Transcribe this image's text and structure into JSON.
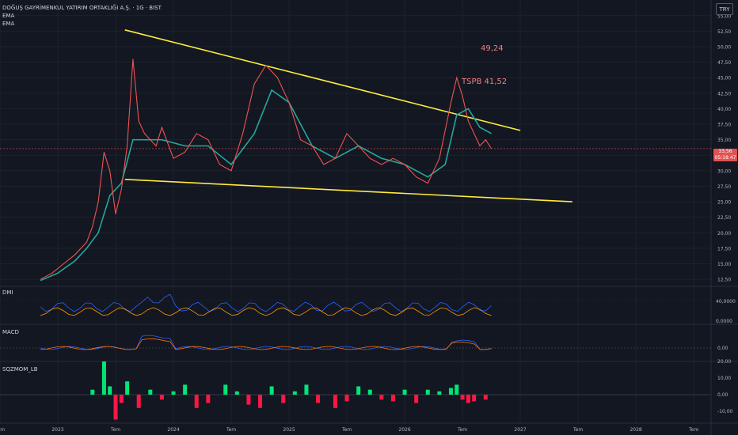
{
  "header": {
    "symbol_line": "DOĞUŞ GAYRİMENKUL YATIRIM ORTAKLIĞI A.Ş. · 1G · BIST",
    "ind1": "EMA",
    "ind2": "EMA"
  },
  "currency": "TRY",
  "annotations": {
    "target": "49,24",
    "tspb": "TSPB  41,52"
  },
  "price_badge": {
    "price": "33,56",
    "countdown": "05:18:47"
  },
  "pane_labels": {
    "dmi": "DMI",
    "macd": "MACD",
    "sqz": "SQZMOM_LB"
  },
  "colors": {
    "background": "#131722",
    "trendline": "#ffeb3b",
    "price": "#ef5350",
    "ema": "#26a69a",
    "dmi_plus": "#2962ff",
    "dmi_minus": "#ff9800",
    "sqz_up": "#00e676",
    "sqz_down": "#ff1744"
  },
  "chart_data": {
    "type": "line",
    "x_axis": {
      "ticks": [
        "Tem",
        "2023",
        "Tem",
        "2024",
        "Tem",
        "2025",
        "Tem",
        "2026",
        "Tem",
        "2027",
        "Tem",
        "2028",
        "Tem"
      ]
    },
    "y_axis": {
      "ticks": [
        "55,00",
        "52,50",
        "50,00",
        "47,50",
        "45,00",
        "42,50",
        "40,00",
        "37,50",
        "35,00",
        "32,50",
        "30,00",
        "27,50",
        "25,00",
        "22,50",
        "20,00",
        "17,50",
        "15,00",
        "12,50"
      ],
      "ylim": [
        11.5,
        56.5
      ]
    },
    "price_series": {
      "x": [
        2022.85,
        2022.95,
        2023.05,
        2023.15,
        2023.25,
        2023.3,
        2023.35,
        2023.4,
        2023.45,
        2023.5,
        2023.55,
        2023.6,
        2023.65,
        2023.7,
        2023.75,
        2023.8,
        2023.85,
        2023.9,
        2024.0,
        2024.1,
        2024.2,
        2024.3,
        2024.4,
        2024.5,
        2024.6,
        2024.7,
        2024.8,
        2024.9,
        2025.0,
        2025.05,
        2025.1,
        2025.2,
        2025.3,
        2025.4,
        2025.5,
        2025.6,
        2025.7,
        2025.8,
        2025.9,
        2026.0,
        2026.1,
        2026.2,
        2026.3,
        2026.4,
        2026.45,
        2026.5,
        2026.55,
        2026.6,
        2026.65,
        2026.7,
        2026.75
      ],
      "values": [
        12.5,
        13.5,
        15,
        16.5,
        18.5,
        21,
        25,
        33,
        30,
        23,
        27,
        34,
        48,
        38,
        36,
        35,
        34,
        37,
        32,
        33,
        36,
        35,
        31,
        30,
        36,
        44,
        47,
        45,
        41,
        38,
        35,
        34,
        31,
        32,
        36,
        34,
        32,
        31,
        32,
        31,
        29,
        28,
        32,
        41,
        45,
        42,
        38,
        36,
        34,
        35,
        33.56
      ]
    },
    "ema_series": {
      "x": [
        2022.85,
        2023.0,
        2023.15,
        2023.25,
        2023.35,
        2023.45,
        2023.55,
        2023.65,
        2023.75,
        2023.9,
        2024.1,
        2024.3,
        2024.5,
        2024.7,
        2024.85,
        2025.0,
        2025.2,
        2025.4,
        2025.6,
        2025.8,
        2026.0,
        2026.2,
        2026.35,
        2026.45,
        2026.55,
        2026.65,
        2026.75
      ],
      "values": [
        12.3,
        13.5,
        15.5,
        17.5,
        20,
        26,
        28,
        35,
        35,
        35,
        34,
        34,
        31,
        36,
        43,
        41,
        34,
        32,
        34,
        32,
        31,
        29,
        31,
        39,
        40,
        37,
        36
      ]
    },
    "trendlines": [
      {
        "from": [
          2023.58,
          52.7
        ],
        "to": [
          2027.0,
          36.5
        ]
      },
      {
        "from": [
          2023.58,
          28.6
        ],
        "to": [
          2027.45,
          25.0
        ]
      }
    ],
    "dmi": {
      "axis_ticks": [
        "40,0000",
        "0,0000"
      ]
    },
    "macd": {
      "axis_ticks": [
        "0,00"
      ]
    },
    "sqzmom": {
      "axis_ticks": [
        "20,00",
        "10,00",
        "0,00",
        "-10,00"
      ],
      "x": [
        2023.3,
        2023.4,
        2023.45,
        2023.5,
        2023.55,
        2023.6,
        2023.7,
        2023.8,
        2023.9,
        2024.0,
        2024.1,
        2024.2,
        2024.3,
        2024.45,
        2024.55,
        2024.65,
        2024.75,
        2024.85,
        2024.95,
        2025.05,
        2025.15,
        2025.25,
        2025.4,
        2025.5,
        2025.6,
        2025.7,
        2025.8,
        2025.9,
        2026.0,
        2026.1,
        2026.2,
        2026.3,
        2026.4,
        2026.45,
        2026.5,
        2026.55,
        2026.6,
        2026.7
      ],
      "values": [
        3,
        20,
        5,
        -15,
        -5,
        8,
        -8,
        3,
        -3,
        2,
        6,
        -8,
        -5,
        6,
        2,
        -6,
        -8,
        5,
        -5,
        2,
        6,
        -5,
        -8,
        -4,
        5,
        3,
        -3,
        -4,
        3,
        -5,
        3,
        2,
        4,
        6,
        -3,
        -5,
        -4,
        -3
      ]
    }
  }
}
